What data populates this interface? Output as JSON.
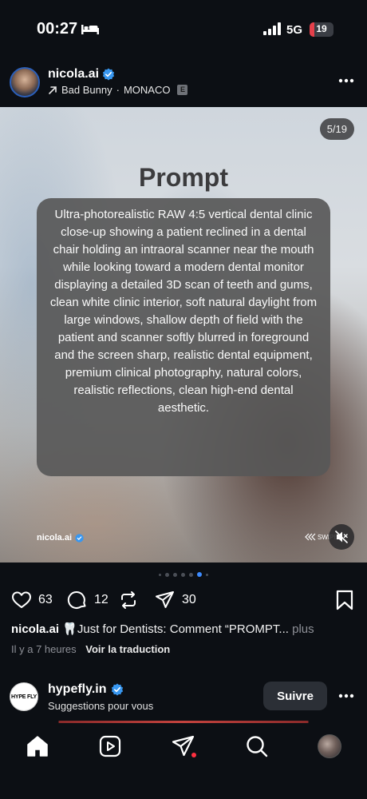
{
  "status": {
    "time": "00:27",
    "network": "5G",
    "battery": "19",
    "battery_fraction": 0.19,
    "icons": [
      "bed-icon",
      "signal-icon",
      "battery-icon"
    ]
  },
  "post": {
    "username": "nicola.ai",
    "audio": "Bad Bunny",
    "location": "MONACO",
    "explicit": "E",
    "separator": "·"
  },
  "media": {
    "counter": "5/19",
    "title": "Prompt",
    "text": "Ultra-photorealistic RAW 4:5 vertical dental clinic close-up showing a patient reclined in a dental chair holding an intraoral scanner near the mouth while looking toward a modern dental monitor displaying a detailed 3D scan of teeth and gums, clean white clinic interior, soft natural daylight from large windows, shallow depth of field with the patient and scanner softly blurred in foreground and the screen sharp, realistic dental equipment, premium clinical photography, natural colors, realistic reflections, clean high-end dental aesthetic.",
    "watermark": "nicola.ai",
    "swipe": "SWIPE"
  },
  "pager": {
    "count": 7,
    "active": 5
  },
  "actions": {
    "likes": "63",
    "comments": "12",
    "shares": "30"
  },
  "caption": {
    "username": "nicola.ai",
    "text": "🦷Just for Dentists: Comment “PROMPT...",
    "more": "plus"
  },
  "meta": {
    "time_ago": "Il y a 7 heures",
    "translate": "Voir la traduction"
  },
  "suggestion": {
    "logo_text": "HYPE FLY",
    "username": "hypefly.in",
    "subtitle": "Suggestions pour vous",
    "follow_label": "Suivre"
  },
  "nav": [
    "home-icon",
    "reels-icon",
    "send-icon",
    "search-icon",
    "profile-avatar"
  ],
  "colors": {
    "accent": "#3d8bff",
    "verified": "#3897f0",
    "notification": "#ff3040",
    "background": "#0c0f14"
  }
}
